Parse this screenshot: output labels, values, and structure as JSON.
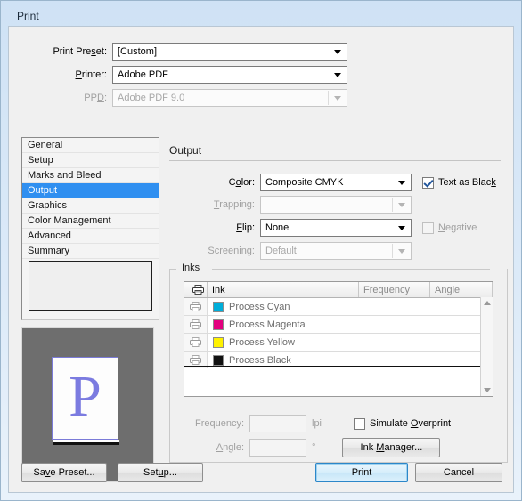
{
  "window": {
    "title": "Print"
  },
  "top_fields": [
    {
      "label": "Print Preset:",
      "accel": "s",
      "value": "[Custom]",
      "enabled": true,
      "name": "print-preset-combo"
    },
    {
      "label": "Printer:",
      "accel": "P",
      "value": "Adobe PDF",
      "enabled": true,
      "name": "printer-combo"
    },
    {
      "label": "PPD:",
      "accel": "D",
      "value": "Adobe PDF 9.0",
      "enabled": false,
      "name": "ppd-combo"
    }
  ],
  "sidebar": {
    "items": [
      {
        "label": "General",
        "selected": false
      },
      {
        "label": "Setup",
        "selected": false
      },
      {
        "label": "Marks and Bleed",
        "selected": false
      },
      {
        "label": "Output",
        "selected": true
      },
      {
        "label": "Graphics",
        "selected": false
      },
      {
        "label": "Color Management",
        "selected": false
      },
      {
        "label": "Advanced",
        "selected": false
      },
      {
        "label": "Summary",
        "selected": false
      }
    ],
    "description": ""
  },
  "preview": {
    "page_glyph": "P",
    "page_color": "#7b7be0",
    "background_color": "#6e6e6e"
  },
  "panel": {
    "title": "Output",
    "fields": [
      {
        "label": "Color:",
        "value": "Composite CMYK",
        "enabled": true,
        "name": "color-combo"
      },
      {
        "label": "Trapping:",
        "value": "",
        "enabled": false,
        "name": "trapping-combo"
      },
      {
        "label": "Flip:",
        "value": "None",
        "enabled": true,
        "name": "flip-combo"
      },
      {
        "label": "Screening:",
        "value": "Default",
        "enabled": false,
        "name": "screening-combo"
      }
    ],
    "checkboxes": {
      "text_as_black": {
        "label": "Text as Black",
        "checked": true,
        "enabled": true
      },
      "negative": {
        "label": "Negative",
        "checked": false,
        "enabled": false
      },
      "simulate_overprint": {
        "label": "Simulate Overprint",
        "checked": false,
        "enabled": true
      }
    }
  },
  "inks": {
    "group_label": "Inks",
    "columns": [
      "",
      "Ink",
      "Frequency",
      "Angle"
    ],
    "rows": [
      {
        "ink": "Process Cyan",
        "swatch": "#00aeda",
        "frequency": "",
        "angle": ""
      },
      {
        "ink": "Process Magenta",
        "swatch": "#e3007f",
        "frequency": "",
        "angle": ""
      },
      {
        "ink": "Process Yellow",
        "swatch": "#fff200",
        "frequency": "",
        "angle": ""
      },
      {
        "ink": "Process Black",
        "swatch": "#111111",
        "frequency": "",
        "angle": ""
      }
    ],
    "frequency_label": "Frequency:",
    "frequency_value": "",
    "frequency_unit": "lpi",
    "angle_label": "Angle:",
    "angle_value": "",
    "angle_unit": "°",
    "ink_manager_label": "Ink Manager..."
  },
  "footer": {
    "save_preset": "Save Preset...",
    "setup": "Setup...",
    "print": "Print",
    "cancel": "Cancel"
  }
}
